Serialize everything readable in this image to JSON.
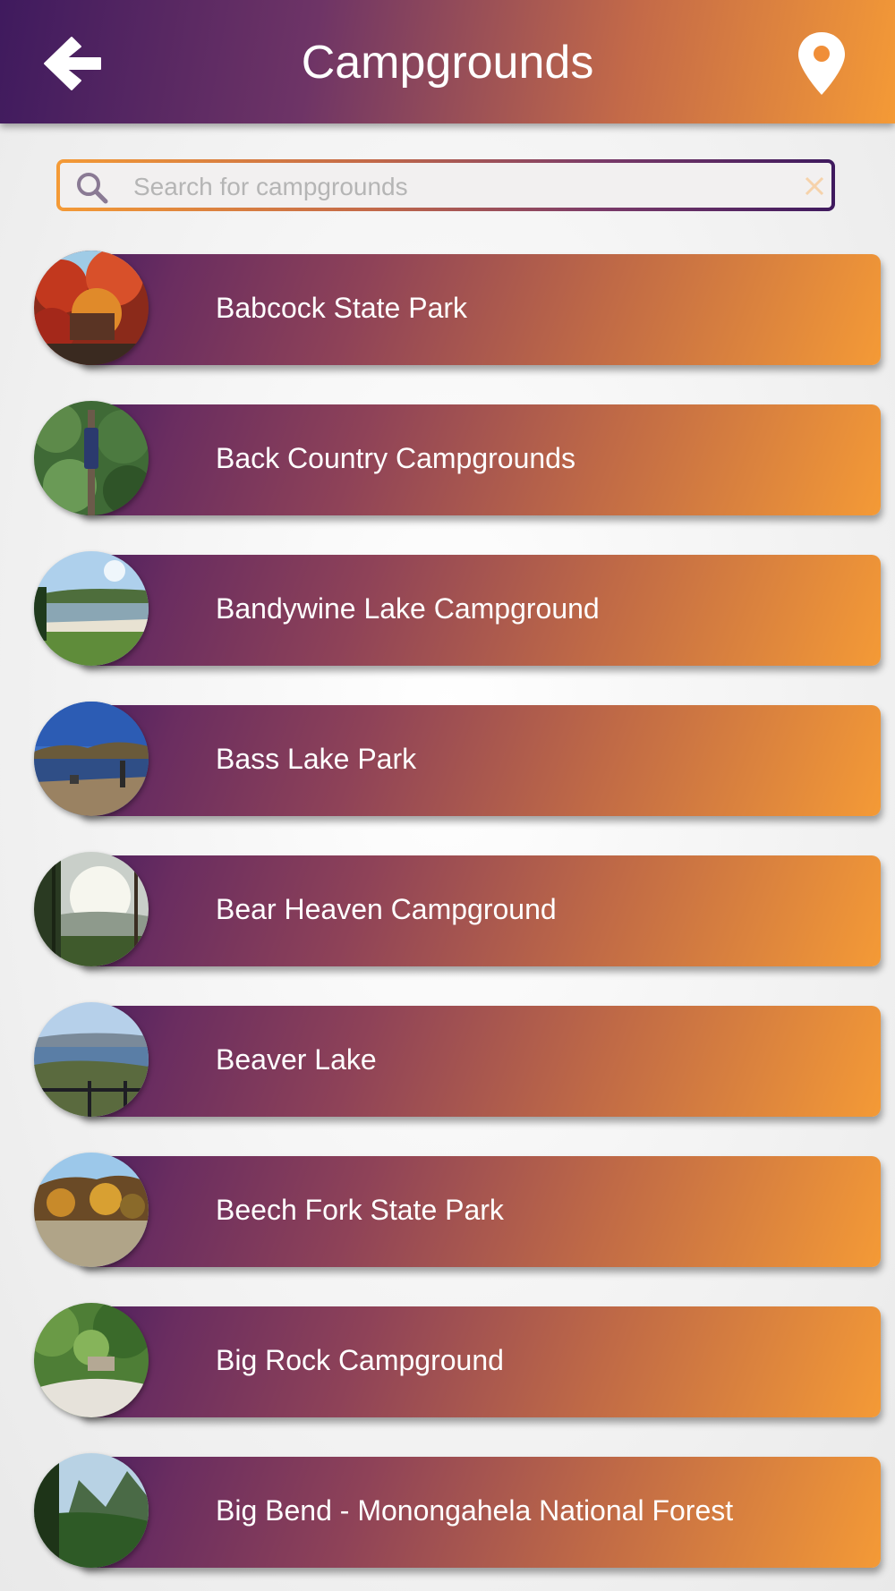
{
  "header": {
    "title": "Campgrounds",
    "back_icon": "arrow-left-icon",
    "map_icon": "map-pin-icon",
    "colors": {
      "start": "#3f1a5e",
      "end": "#f49a36"
    }
  },
  "search": {
    "placeholder": "Search for campgrounds",
    "value": "",
    "icon": "search-icon",
    "clear_icon": "close-icon"
  },
  "list": {
    "items": [
      {
        "label": "Babcock State Park"
      },
      {
        "label": "Back Country Campgrounds"
      },
      {
        "label": "Bandywine Lake Campground"
      },
      {
        "label": "Bass Lake Park"
      },
      {
        "label": "Bear Heaven Campground"
      },
      {
        "label": "Beaver Lake"
      },
      {
        "label": "Beech Fork State Park"
      },
      {
        "label": "Big Rock Campground"
      },
      {
        "label": "Big Bend - Monongahela National Forest"
      }
    ]
  }
}
